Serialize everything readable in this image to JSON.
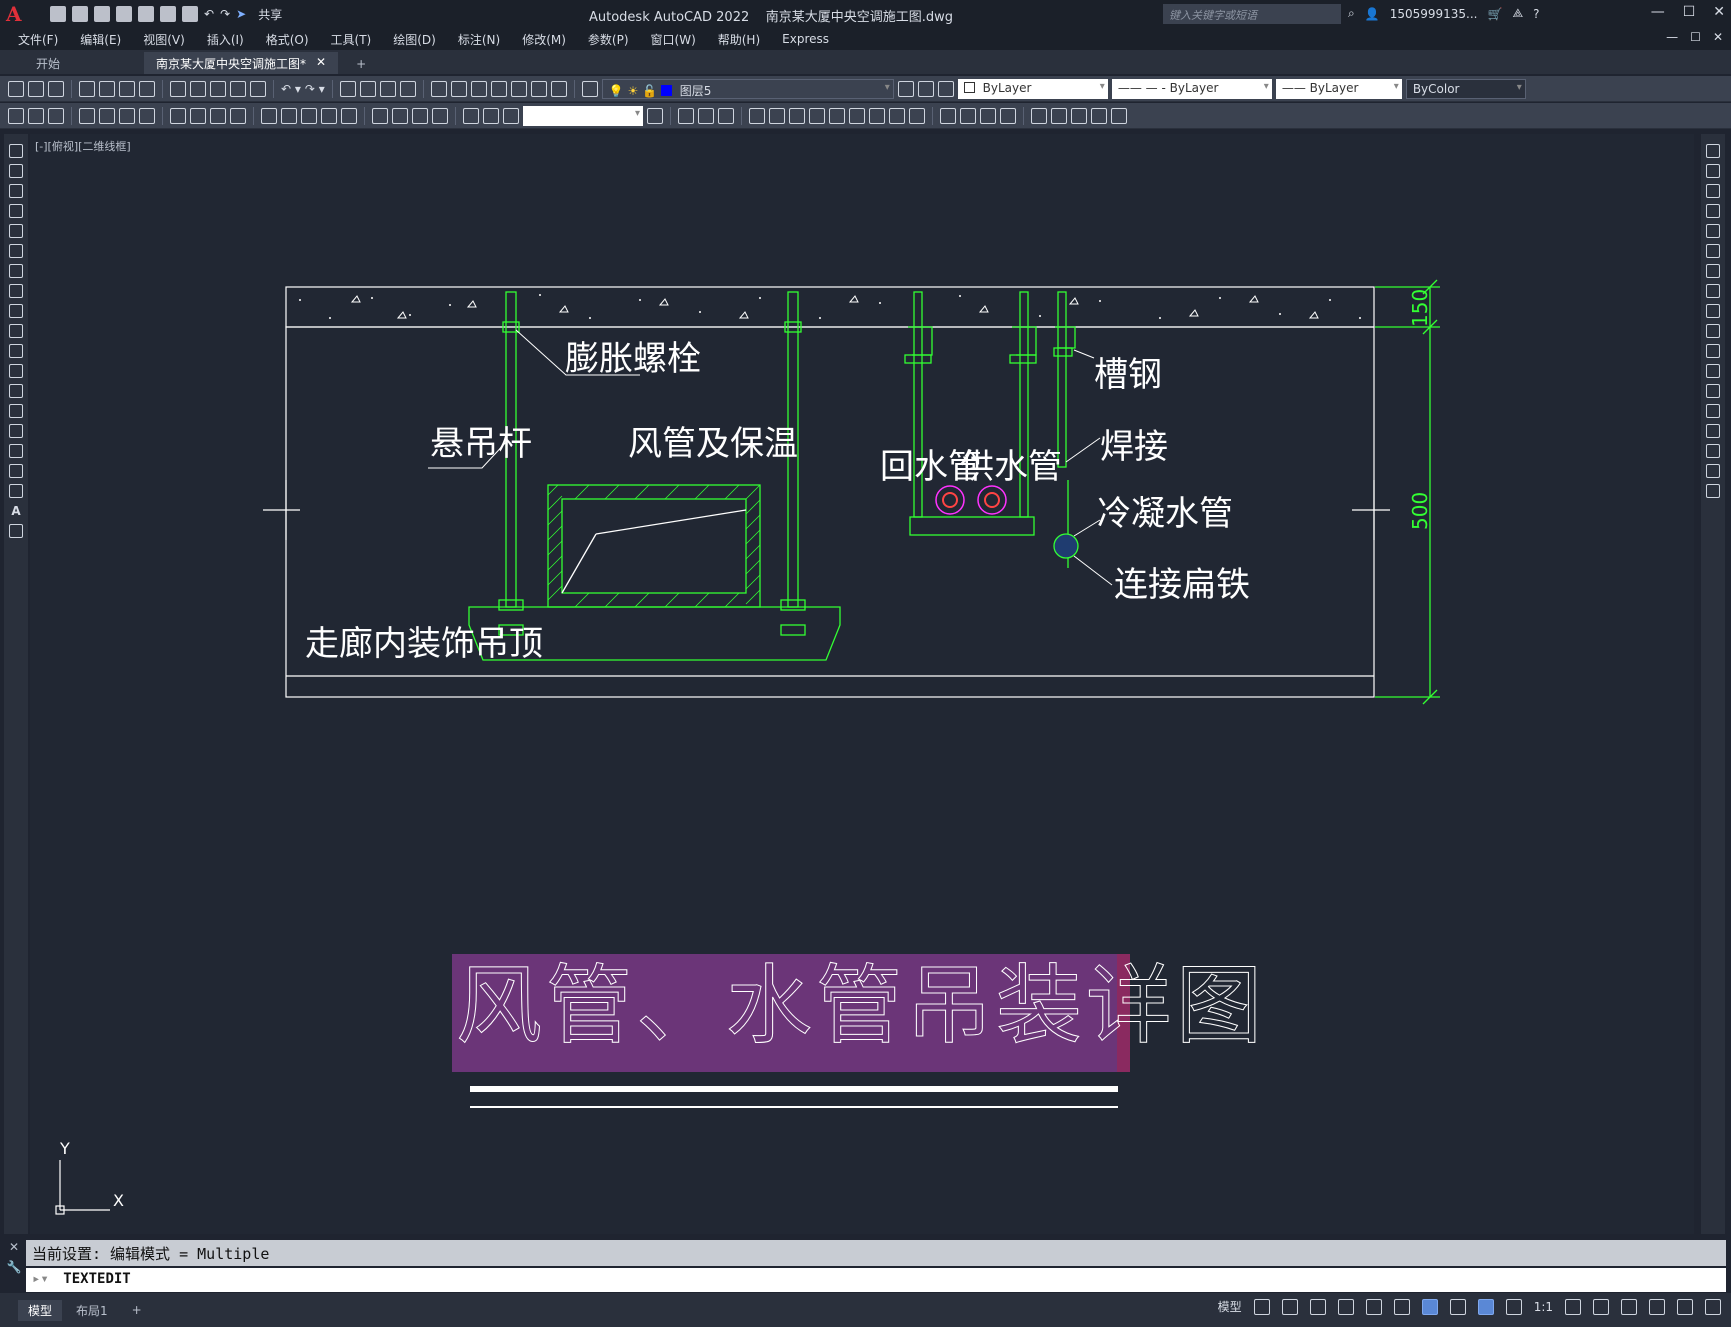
{
  "app": {
    "logo": "A",
    "title": "Autodesk AutoCAD 2022",
    "file": "南京某大厦中央空调施工图.dwg",
    "share": "共享",
    "search_placeholder": "键入关键字或短语",
    "user": "1505999135...",
    "help": "?"
  },
  "window_controls": [
    "—",
    "☐",
    "✕"
  ],
  "menus": [
    "文件(F)",
    "编辑(E)",
    "视图(V)",
    "插入(I)",
    "格式(O)",
    "工具(T)",
    "绘图(D)",
    "标注(N)",
    "修改(M)",
    "参数(P)",
    "窗口(W)",
    "帮助(H)",
    "Express"
  ],
  "doc_tabs": {
    "start": "开始",
    "active": "南京某大厦中央空调施工图*",
    "close": "✕",
    "add": "+"
  },
  "properties": {
    "layer": "图层5",
    "color": "ByLayer",
    "linetype": "ByLayer",
    "lineweight": "ByLayer",
    "plotstyle": "ByColor"
  },
  "viewport_label": "[-][俯视][二维线框]",
  "drawing": {
    "labels": {
      "bolt": "膨胀螺栓",
      "rod": "悬吊杆",
      "duct": "风管及保温",
      "return_pipe": "回水管",
      "supply_pipe": "供水管",
      "channel_steel": "槽钢",
      "weld": "焊接",
      "condensate": "冷凝水管",
      "flat_iron": "连接扁铁",
      "ceiling": "走廊内装饰吊顶"
    },
    "dims": {
      "slab": "150",
      "height": "500"
    },
    "title": "风管、水管吊装详图"
  },
  "ucs": {
    "x": "X",
    "y": "Y"
  },
  "command": {
    "history": "当前设置: 编辑模式 = Multiple",
    "current": "TEXTEDIT"
  },
  "status": {
    "model_tab": "模型",
    "layout_tab": "布局1",
    "add": "+",
    "model_label": "模型",
    "scale": "1:1"
  }
}
